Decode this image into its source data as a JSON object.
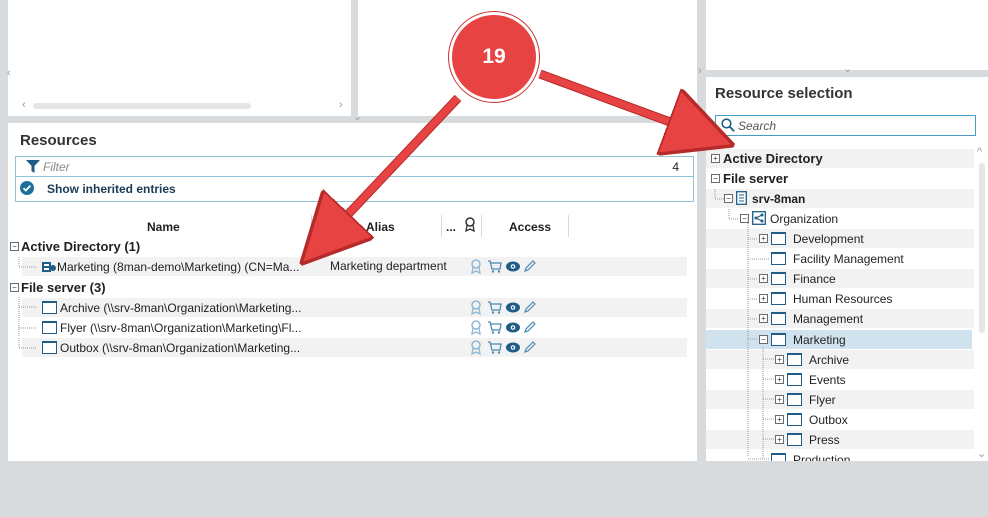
{
  "resources": {
    "title": "Resources",
    "filter_placeholder": "Filter",
    "count": "4",
    "show_inherited": "Show inherited entries",
    "columns": {
      "name": "Name",
      "alias": "Alias",
      "more": "...",
      "access": "Access"
    },
    "groups": [
      {
        "label": "Active Directory (1)"
      },
      {
        "label": "File server (3)"
      }
    ],
    "rows": [
      {
        "name": "Marketing (8man-demo\\Marketing) (CN=Ma...",
        "alias": "Marketing department"
      },
      {
        "name": "Archive (\\\\srv-8man\\Organization\\Marketing...",
        "alias": ""
      },
      {
        "name": "Flyer (\\\\srv-8man\\Organization\\Marketing\\Fl...",
        "alias": ""
      },
      {
        "name": "Outbox (\\\\srv-8man\\Organization\\Marketing...",
        "alias": ""
      }
    ]
  },
  "resource_selection": {
    "title": "Resource selection",
    "search_placeholder": "Search",
    "tree": [
      {
        "label": "Active Directory"
      },
      {
        "label": "File server"
      },
      {
        "label": "srv-8man"
      },
      {
        "label": "Organization"
      },
      {
        "label": "Development"
      },
      {
        "label": "Facility Management"
      },
      {
        "label": "Finance"
      },
      {
        "label": "Human Resources"
      },
      {
        "label": "Management"
      },
      {
        "label": "Marketing"
      },
      {
        "label": "Archive"
      },
      {
        "label": "Events"
      },
      {
        "label": "Flyer"
      },
      {
        "label": "Outbox"
      },
      {
        "label": "Press"
      },
      {
        "label": "Production"
      }
    ]
  },
  "annotation": {
    "step": "19",
    "color": "#e84343"
  },
  "colors": {
    "accent": "#1f6f9a",
    "selection": "#cfe2ee",
    "divider": "#d7dbde"
  }
}
